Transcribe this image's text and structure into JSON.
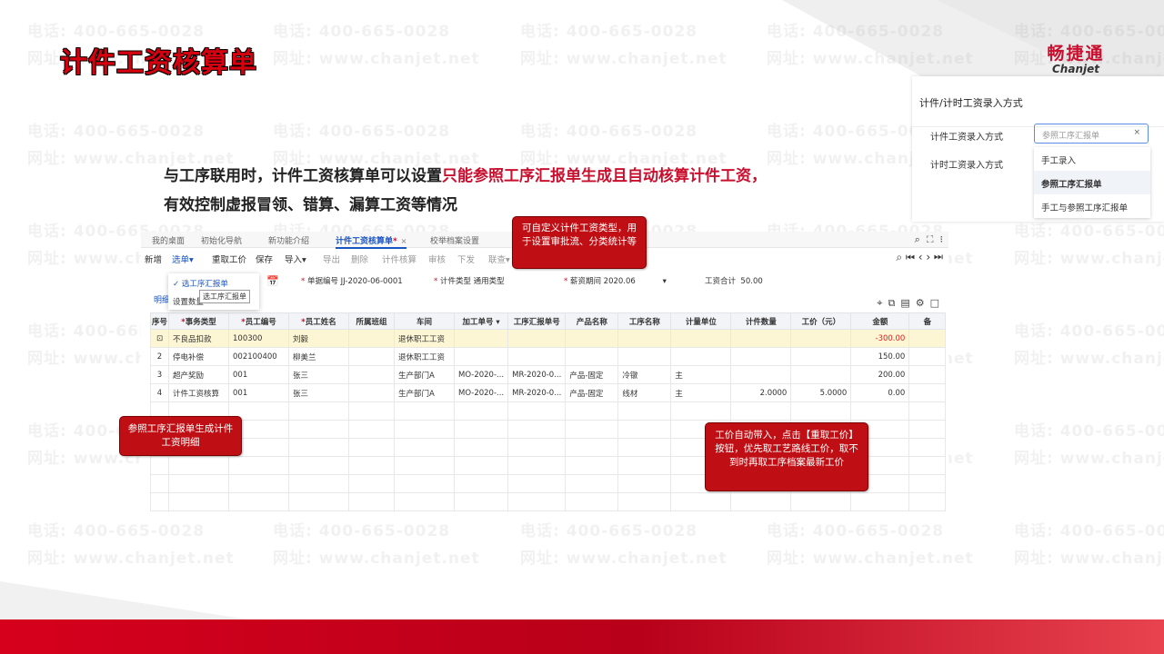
{
  "slide": {
    "title": "计件工资核算单",
    "logo_cn": "畅捷通",
    "logo_en": "Chanjet",
    "watermark_phone": "电话: 400-665-0028",
    "watermark_url": "网址: www.chanjet.net",
    "desc_part1": "与工序联用时，计件工资核算单可以设置",
    "desc_highlight": "只能参照工序汇报单生成且自动核算计件工资，",
    "desc_part2": "有效控制虚报冒领、错算、漏算工资等情况"
  },
  "panel": {
    "title": "计件/计时工资录入方式",
    "label_piece": "计件工资录入方式",
    "label_time": "计时工资录入方式",
    "placeholder": "参照工序汇报单",
    "options": [
      "手工录入",
      "参照工序汇报单",
      "手工与参照工序汇报单"
    ]
  },
  "app": {
    "tabs": [
      "我的桌面",
      "初始化导航",
      "新功能介绍",
      "计件工资核算单",
      "校举档案设置"
    ],
    "active_tab_suffix": "*",
    "toolbar": [
      "新增",
      "选单",
      "重取工价",
      "保存",
      "导入",
      "导出",
      "删除",
      "计件核算",
      "审核",
      "下发",
      "联查"
    ],
    "menu": {
      "item1": "选工序汇报单",
      "item2": "设置数量",
      "tip": "选工序汇报单"
    },
    "form": {
      "doc_no_label": "单据编号",
      "doc_no": "JJ-2020-06-0001",
      "type_label": "计件类型",
      "type": "通用类型",
      "period_label": "薪资期间",
      "period": "2020.06",
      "total_label": "工资合计",
      "total": "50.00"
    },
    "detail_tab": "明细",
    "columns": [
      "序号",
      "事务类型",
      "员工编号",
      "员工姓名",
      "所属班组",
      "车间",
      "加工单号",
      "工序汇报单号",
      "产品名称",
      "工序名称",
      "计量单位",
      "计件数量",
      "工价（元）",
      "金额",
      "备"
    ],
    "rows": [
      [
        "⊡",
        "不良品扣款",
        "100300",
        "刘毅",
        "",
        "退休职工工资",
        "",
        "",
        "",
        "",
        "",
        "",
        "",
        "-300.00",
        ""
      ],
      [
        "2",
        "停电补偿",
        "002100400",
        "柳美兰",
        "",
        "退休职工工资",
        "",
        "",
        "",
        "",
        "",
        "",
        "",
        "150.00",
        ""
      ],
      [
        "3",
        "超产奖励",
        "001",
        "张三",
        "",
        "生产部门A",
        "MO-2020-...",
        "MR-2020-0...",
        "产品-固定",
        "冷镦",
        "主",
        "",
        "",
        "200.00",
        ""
      ],
      [
        "4",
        "计件工资核算",
        "001",
        "张三",
        "",
        "生产部门A",
        "MO-2020-...",
        "MR-2020-0...",
        "产品-固定",
        "线材",
        "主",
        "2.0000",
        "5.0000",
        "0.00",
        ""
      ]
    ]
  },
  "callouts": {
    "top": "可自定义计件工资类型，用于设置审批流、分类统计等",
    "left": "参照工序汇报单生成计件工资明细",
    "right": "工价自动带入，点击【重取工价】按钮，优先取工艺路线工价，取不到时再取工序档案最新工价"
  },
  "colors": {
    "accent_red": "#c8102e",
    "link_blue": "#1a55c5",
    "highlight_row": "#fdf6d5"
  }
}
